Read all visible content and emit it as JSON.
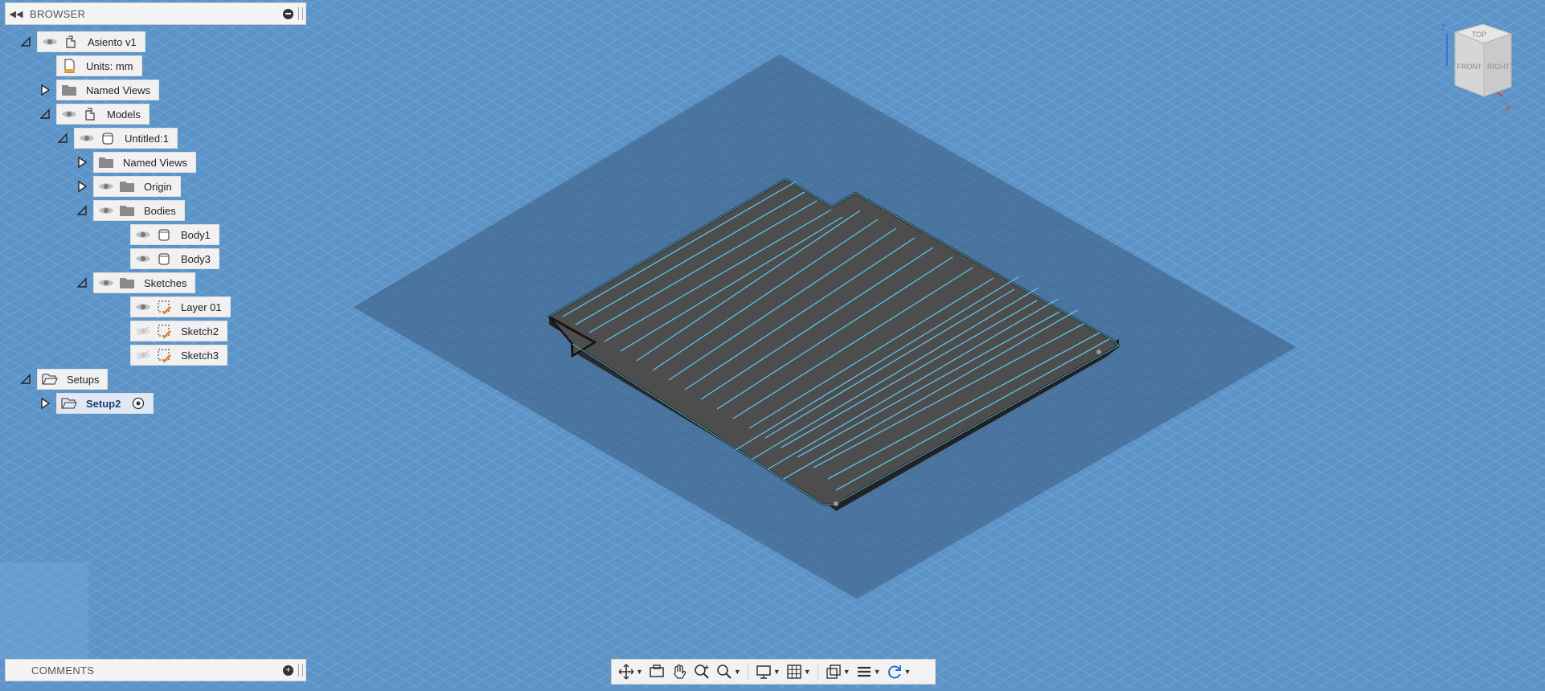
{
  "browser": {
    "title": "BROWSER",
    "tree": [
      {
        "label": "Asiento v1",
        "icon": "component-icon",
        "eye": "visible",
        "toggle": "expanded",
        "level": 0
      },
      {
        "label": "Units: mm",
        "icon": "document-units-icon",
        "eye": "none",
        "toggle": "none",
        "level": 1
      },
      {
        "label": "Named Views",
        "icon": "folder-icon",
        "eye": "none",
        "toggle": "collapsed",
        "level": 1
      },
      {
        "label": "Models",
        "icon": "component-icon",
        "eye": "visible",
        "toggle": "expanded",
        "level": 1
      },
      {
        "label": "Untitled:1",
        "icon": "body-icon",
        "eye": "visible",
        "toggle": "expanded",
        "level": 2
      },
      {
        "label": "Named Views",
        "icon": "folder-icon",
        "eye": "none",
        "toggle": "collapsed",
        "level": 3
      },
      {
        "label": "Origin",
        "icon": "folder-icon",
        "eye": "visible",
        "toggle": "collapsed",
        "level": 3
      },
      {
        "label": "Bodies",
        "icon": "folder-icon",
        "eye": "visible",
        "toggle": "expanded",
        "level": 3
      },
      {
        "label": "Body1",
        "icon": "body-icon",
        "eye": "visible",
        "toggle": "none",
        "level": 4
      },
      {
        "label": "Body3",
        "icon": "body-icon",
        "eye": "visible",
        "toggle": "none",
        "level": 4
      },
      {
        "label": "Sketches",
        "icon": "folder-icon",
        "eye": "visible",
        "toggle": "expanded",
        "level": 3
      },
      {
        "label": "Layer 01",
        "icon": "sketch-icon",
        "eye": "visible",
        "toggle": "none",
        "level": 4
      },
      {
        "label": "Sketch2",
        "icon": "sketch-icon",
        "eye": "hidden",
        "toggle": "none",
        "level": 4
      },
      {
        "label": "Sketch3",
        "icon": "sketch-icon",
        "eye": "hidden",
        "toggle": "none",
        "level": 4
      },
      {
        "label": "Setups",
        "icon": "open-folder-icon",
        "eye": "none",
        "toggle": "expanded",
        "level": 0
      },
      {
        "label": "Setup2",
        "icon": "open-folder-icon",
        "eye": "none",
        "toggle": "collapsed",
        "level": 1,
        "active": true
      }
    ]
  },
  "comments": {
    "title": "COMMENTS"
  },
  "viewcube": {
    "top": "TOP",
    "front": "FRONT",
    "right": "RIGHT",
    "axis_z": "Z",
    "axis_x": "X"
  },
  "nav_toolbar": {
    "buttons": [
      "orbit-icon",
      "look-at-icon",
      "pan-icon",
      "zoom-icon",
      "zoom-window-icon",
      "display-settings-icon",
      "grid-icon",
      "viewports-icon",
      "layers-icon",
      "refresh-icon"
    ]
  },
  "colors": {
    "viewport_bg": "#5d94c8",
    "grid_line": "#86b4e0",
    "plane": "#3f5e80",
    "part_face": "#4f4f4f",
    "part_edge": "#1b1b1b",
    "sketch_line": "#5ec3e8",
    "panel_bg": "#f1f1f1",
    "active_label": "#1a3e6e"
  }
}
